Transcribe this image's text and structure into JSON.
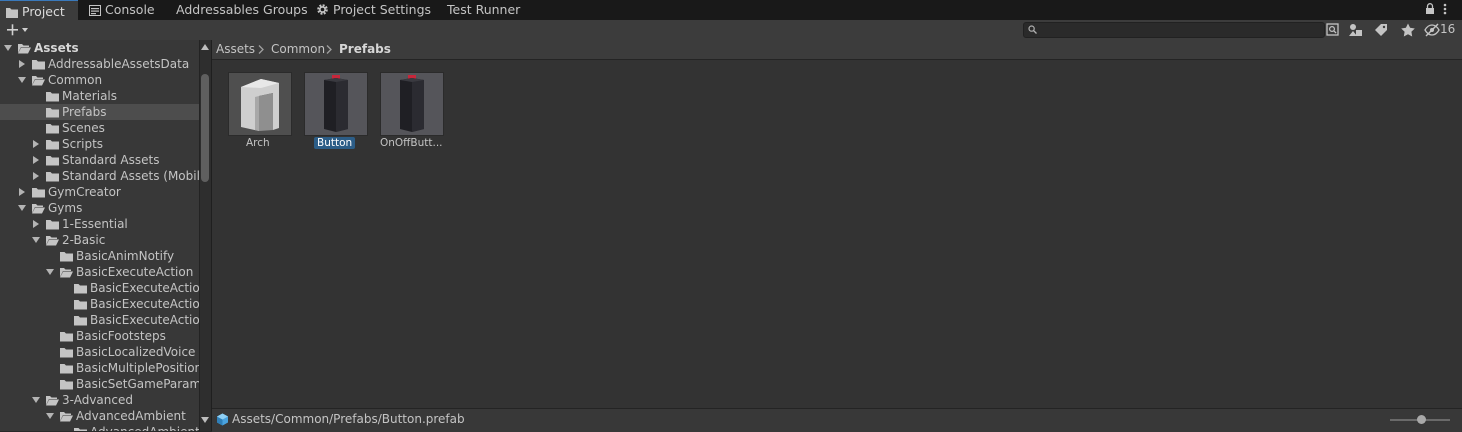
{
  "tabs": [
    {
      "label": "Project",
      "icon": "folder-icon",
      "active": true
    },
    {
      "label": "Console",
      "icon": "console-icon",
      "active": false
    },
    {
      "label": "Addressables Groups",
      "icon": "",
      "active": false
    },
    {
      "label": "Project Settings",
      "icon": "gear-icon",
      "active": false
    },
    {
      "label": "Test Runner",
      "icon": "",
      "active": false
    }
  ],
  "toolbar": {
    "create_label": "+",
    "search_placeholder": "",
    "hidden_count": "16"
  },
  "tree": [
    {
      "label": "Assets",
      "depth": 0,
      "expanded": true,
      "hasArrow": true,
      "bold": true
    },
    {
      "label": "AddressableAssetsData",
      "depth": 1,
      "expanded": false,
      "hasArrow": true
    },
    {
      "label": "Common",
      "depth": 1,
      "expanded": true,
      "hasArrow": true
    },
    {
      "label": "Materials",
      "depth": 2,
      "hasArrow": false
    },
    {
      "label": "Prefabs",
      "depth": 2,
      "hasArrow": false,
      "selected": true
    },
    {
      "label": "Scenes",
      "depth": 2,
      "hasArrow": false
    },
    {
      "label": "Scripts",
      "depth": 2,
      "expanded": false,
      "hasArrow": true
    },
    {
      "label": "Standard Assets",
      "depth": 2,
      "expanded": false,
      "hasArrow": true
    },
    {
      "label": "Standard Assets (Mobile",
      "depth": 2,
      "expanded": false,
      "hasArrow": true
    },
    {
      "label": "GymCreator",
      "depth": 1,
      "expanded": false,
      "hasArrow": true
    },
    {
      "label": "Gyms",
      "depth": 1,
      "expanded": true,
      "hasArrow": true
    },
    {
      "label": "1-Essential",
      "depth": 2,
      "expanded": false,
      "hasArrow": true
    },
    {
      "label": "2-Basic",
      "depth": 2,
      "expanded": true,
      "hasArrow": true
    },
    {
      "label": "BasicAnimNotify",
      "depth": 3,
      "hasArrow": false
    },
    {
      "label": "BasicExecuteAction",
      "depth": 3,
      "expanded": true,
      "hasArrow": true
    },
    {
      "label": "BasicExecuteActior",
      "depth": 4,
      "hasArrow": false
    },
    {
      "label": "BasicExecuteActior",
      "depth": 4,
      "hasArrow": false
    },
    {
      "label": "BasicExecuteActior",
      "depth": 4,
      "hasArrow": false
    },
    {
      "label": "BasicFootsteps",
      "depth": 3,
      "hasArrow": false
    },
    {
      "label": "BasicLocalizedVoice",
      "depth": 3,
      "hasArrow": false
    },
    {
      "label": "BasicMultiplePosition",
      "depth": 3,
      "hasArrow": false
    },
    {
      "label": "BasicSetGameParame",
      "depth": 3,
      "hasArrow": false
    },
    {
      "label": "3-Advanced",
      "depth": 2,
      "expanded": true,
      "hasArrow": true
    },
    {
      "label": "AdvancedAmbient",
      "depth": 3,
      "expanded": true,
      "hasArrow": true
    },
    {
      "label": "AdvancedAmbientF",
      "depth": 4,
      "hasArrow": false
    }
  ],
  "breadcrumb": [
    "Assets",
    "Common",
    "Prefabs"
  ],
  "assets": [
    {
      "label": "Arch",
      "kind": "arch",
      "selected": false
    },
    {
      "label": "Button",
      "kind": "button",
      "selected": true
    },
    {
      "label": "OnOffButt...",
      "kind": "button",
      "selected": false
    }
  ],
  "status": {
    "path": "Assets/Common/Prefabs/Button.prefab",
    "zoom": 0.45
  }
}
